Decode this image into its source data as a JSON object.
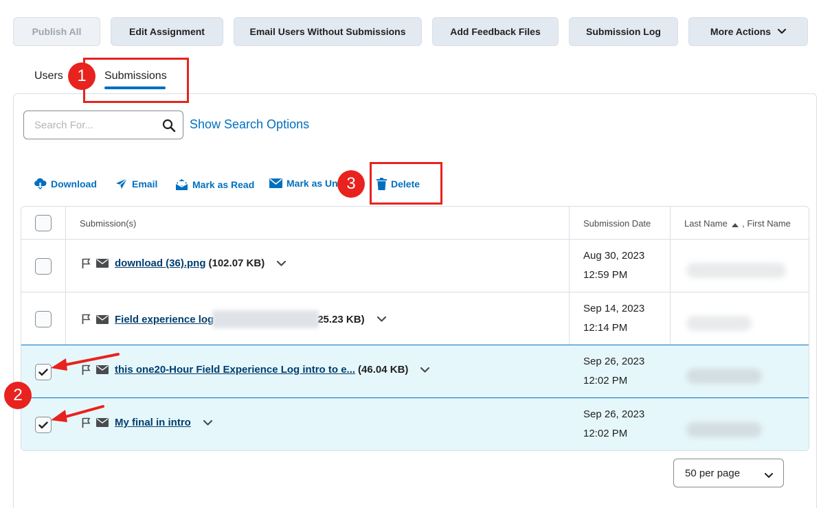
{
  "toolbar": {
    "publish_all": "Publish All",
    "edit_assignment": "Edit Assignment",
    "email_users": "Email Users Without Submissions",
    "add_feedback": "Add Feedback Files",
    "submission_log": "Submission Log",
    "more_actions": "More Actions"
  },
  "tabs": [
    {
      "label": "Users",
      "active": false
    },
    {
      "label": "Submissions",
      "active": true
    }
  ],
  "search": {
    "placeholder": "Search For...",
    "value": "",
    "show_options": "Show Search Options"
  },
  "bulk_actions": {
    "download": "Download",
    "email": "Email",
    "mark_read": "Mark as Read",
    "mark_unread": "Mark as Un",
    "delete": "Delete"
  },
  "table": {
    "headers": {
      "submissions": "Submission(s)",
      "date": "Submission Date",
      "last_name": "Last Name",
      "first_name": ", First Name"
    },
    "rows": [
      {
        "file": "download (36).png",
        "size": "(102.07 KB)",
        "date": "Aug 30, 2023",
        "time": "12:59 PM",
        "checked": false
      },
      {
        "file": "Field experience log",
        "size": "25.23 KB)",
        "date": "Sep 14, 2023",
        "time": "12:14 PM",
        "checked": false
      },
      {
        "file": "this one20-Hour Field Experience Log intro to e...",
        "size": "(46.04 KB)",
        "date": "Sep 26, 2023",
        "time": "12:02 PM",
        "checked": true
      },
      {
        "file": "My final in intro",
        "size": "",
        "date": "Sep 26, 2023",
        "time": "12:02 PM",
        "checked": true
      }
    ]
  },
  "pager": {
    "per_page": "50 per page"
  },
  "annotations": {
    "step1": "1",
    "step2": "2",
    "step3": "3",
    "color": "#e8221e"
  },
  "colors": {
    "link": "#006fbf",
    "selected_row": "#e6f7fb",
    "button_bg": "#e3e9f1"
  }
}
